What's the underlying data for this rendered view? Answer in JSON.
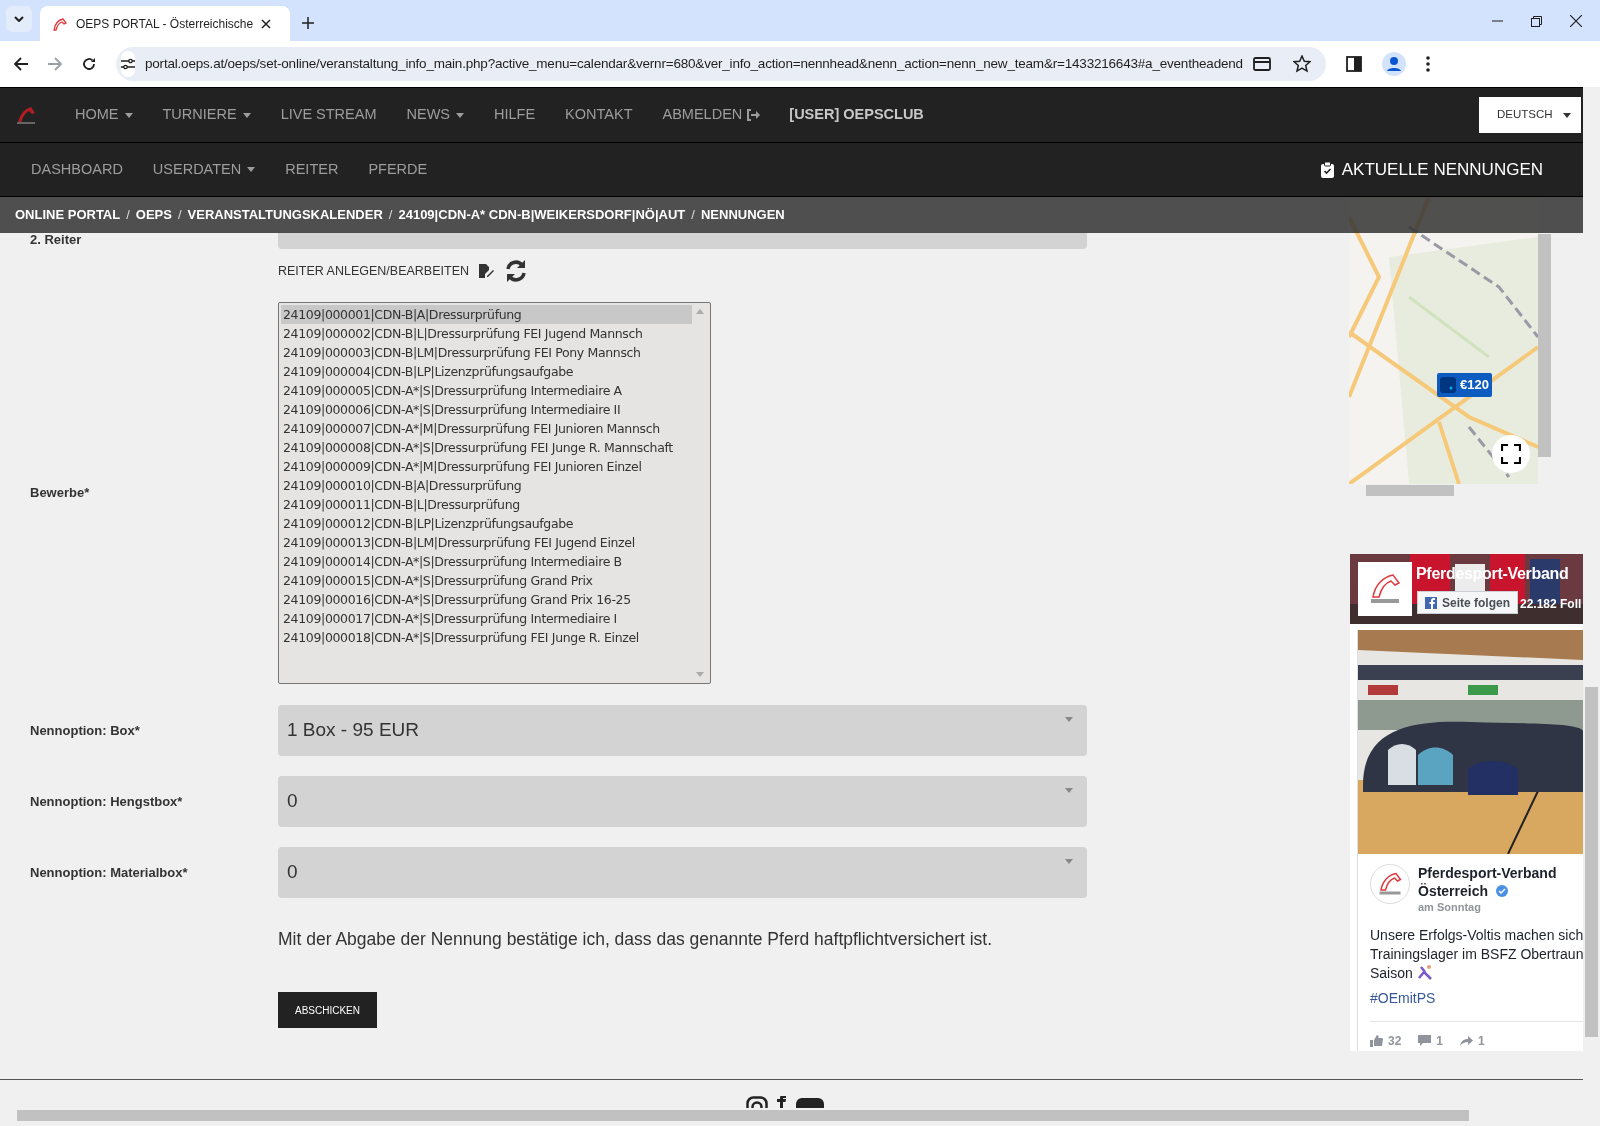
{
  "browser": {
    "tab_title": "OEPS PORTAL - Österreichische",
    "url": "portal.oeps.at/oeps/set-online/veranstaltung_info_main.php?active_menu=calendar&vernr=680&ver_info_action=nennhead&nenn_action=nenn_new_team&r=1433216643#a_eventheadend"
  },
  "main_nav": [
    {
      "label": "HOME",
      "kind": "dropdown"
    },
    {
      "label": "TURNIERE",
      "kind": "dropdown"
    },
    {
      "label": "LIVE STREAM",
      "kind": "link"
    },
    {
      "label": "NEWS",
      "kind": "dropdown"
    },
    {
      "label": "HILFE",
      "kind": "link"
    },
    {
      "label": "KONTAKT",
      "kind": "link"
    },
    {
      "label": "ABMELDEN",
      "kind": "logout"
    },
    {
      "label": "[USER] OEPSCLUB",
      "kind": "user"
    }
  ],
  "language": "DEUTSCH",
  "sub_nav": [
    {
      "label": "DASHBOARD",
      "kind": "link"
    },
    {
      "label": "USERDATEN",
      "kind": "dropdown"
    },
    {
      "label": "REITER",
      "kind": "link"
    },
    {
      "label": "PFERDE",
      "kind": "link"
    }
  ],
  "current_entries": "AKTUELLE NENNUNGEN",
  "breadcrumb": [
    {
      "label": "ONLINE PORTAL",
      "separator": "/"
    },
    {
      "label": "OEPS",
      "separator": "/"
    },
    {
      "label": "VERANSTALTUNGSKALENDER",
      "separator": "/"
    },
    {
      "label": "24109|CDN-A* CDN-B|WEIKERSDORF|NÖ|AUT",
      "separator": "/"
    },
    {
      "label": "NENNUNGEN"
    }
  ],
  "form": {
    "rider_label": "2. Reiter",
    "rider_link": "REITER ANLEGEN/BEARBEITEN",
    "competitions_label": "Bewerbe*",
    "competitions": [
      {
        "label": "24109|000001|CDN-B|A|Dressurprüfung",
        "selected": true
      },
      {
        "label": "24109|000002|CDN-B|L|Dressurprüfung FEI Jugend Mannsch",
        "selected": false
      },
      {
        "label": "24109|000003|CDN-B|LM|Dressurprüfung FEI Pony Mannsch",
        "selected": false
      },
      {
        "label": "24109|000004|CDN-B|LP|Lizenzprüfungsaufgabe",
        "selected": false
      },
      {
        "label": "24109|000005|CDN-A*|S|Dressurprüfung Intermediaire A",
        "selected": false
      },
      {
        "label": "24109|000006|CDN-A*|S|Dressurprüfung Intermediaire II",
        "selected": false
      },
      {
        "label": "24109|000007|CDN-A*|M|Dressurprüfung FEI Junioren Mannsch",
        "selected": false
      },
      {
        "label": "24109|000008|CDN-A*|S|Dressurprüfung FEI Junge R. Mannschaft",
        "selected": false
      },
      {
        "label": "24109|000009|CDN-A*|M|Dressurprüfung FEI Junioren Einzel",
        "selected": false
      },
      {
        "label": "24109|000010|CDN-B|A|Dressurprüfung",
        "selected": false
      },
      {
        "label": "24109|000011|CDN-B|L|Dressurprüfung",
        "selected": false
      },
      {
        "label": "24109|000012|CDN-B|LP|Lizenzprüfungsaufgabe",
        "selected": false
      },
      {
        "label": "24109|000013|CDN-B|LM|Dressurprüfung FEI Jugend Einzel",
        "selected": false
      },
      {
        "label": "24109|000014|CDN-A*|S|Dressurprüfung Intermediaire B",
        "selected": false
      },
      {
        "label": "24109|000015|CDN-A*|S|Dressurprüfung Grand Prix",
        "selected": false
      },
      {
        "label": "24109|000016|CDN-A*|S|Dressurprüfung Grand Prix 16-25",
        "selected": false
      },
      {
        "label": "24109|000017|CDN-A*|S|Dressurprüfung Intermediaire I",
        "selected": false
      },
      {
        "label": "24109|000018|CDN-A*|S|Dressurprüfung FEI Junge R. Einzel",
        "selected": false
      }
    ],
    "options": [
      {
        "label": "Nennoption: Box*",
        "value": "1 Box - 95 EUR"
      },
      {
        "label": "Nennoption: Hengstbox*",
        "value": "0"
      },
      {
        "label": "Nennoption: Materialbox*",
        "value": "0"
      }
    ],
    "notice": "Mit der Abgabe der Nennung bestätige ich, dass das genannte Pferd haftpflichtversichert ist.",
    "submit": "ABSCHICKEN"
  },
  "map": {
    "price": "€120"
  },
  "facebook": {
    "page_name": "Pferdesport-Verband",
    "follow": "Seite folgen",
    "followers": "22.182 Foll",
    "post": {
      "author_lines": [
        "Pferdesport-Verband",
        "Österreich"
      ],
      "verified": true,
      "time": "am Sonntag",
      "text_lines": [
        "Unsere Erfolgs-Voltis machen sich",
        "Trainingslager im BSFZ Obertraun",
        "Saison"
      ],
      "hashtag": "#OEmitPS",
      "likes": "32",
      "comments": "1",
      "shares": "1"
    }
  }
}
